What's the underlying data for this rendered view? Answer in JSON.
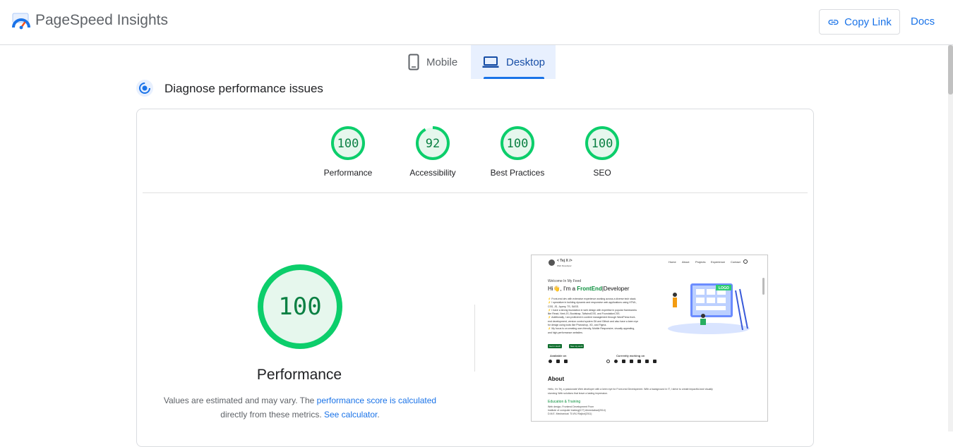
{
  "header": {
    "brand": "PageSpeed Insights",
    "copy_link_label": "Copy Link",
    "docs_label": "Docs"
  },
  "tabs": [
    {
      "label": "Mobile",
      "icon": "phone-icon",
      "selected": false
    },
    {
      "label": "Desktop",
      "icon": "laptop-icon",
      "selected": true
    }
  ],
  "section_title": "Diagnose performance issues",
  "scores": [
    {
      "label": "Performance",
      "value": "100",
      "fraction": 1.0
    },
    {
      "label": "Accessibility",
      "value": "92",
      "fraction": 0.92
    },
    {
      "label": "Best Practices",
      "value": "100",
      "fraction": 1.0
    },
    {
      "label": "SEO",
      "value": "100",
      "fraction": 1.0
    }
  ],
  "main_score": {
    "value": "100",
    "title": "Performance",
    "text1": "Values are estimated and may vary. The ",
    "link1": "performance score is calculated",
    "text2": "directly from these metrics. ",
    "link2": "See calculator",
    "text3": "."
  },
  "preview": {
    "logo_text": "< Tej X />",
    "logo_sub": "Web Developer",
    "nav": [
      "Home",
      "About",
      "Projects",
      "Experience",
      "Contact"
    ],
    "welcome": "Welcome In My Feed",
    "hero_prefix": "Hi👋, I'm a",
    "hero_highlight": "FrontEnd",
    "hero_suffix": "|Developer",
    "bullets": [
      "⚡ Front-end dev with extensive experience working across a diverse tech stack.",
      "⚡ I specialize in building dynamic and responsive web applications using HTML,",
      "CSS, JS, Jquery, TS, SASS.",
      "⚡ I have a strong foundation in web design with expertise in popular frameworks",
      "like React, Next.JS, Bootstrap, TailwindCSS, and FoundationCSS.",
      "⚡ Additionally, I am proficient in content management through WordPress front-",
      "end development, version control system Git and Github and also have a keen eye",
      "for design using tools like Photoshop, XD, and Figma.",
      "⚡ My focus is on creating user-friendly, Mobile Responsive, visually appealing,",
      "and high-performance websites."
    ],
    "btn1": "Get in touch",
    "btn2": "See my work",
    "available_on": "Available on",
    "currently": "Currently working on",
    "about_title": "About",
    "about_text1": "Hello, I'm Tej, a passionate Web developer with a keen eye for Front-end Development. With a background in IT, I strive to create impactful and visually",
    "about_text2": "stunning Web solutions that leave a lasting impression.",
    "edu_title": "Education & Training",
    "edu_lines": [
      "Web design, Frontend Development From",
      "Institute of computer training(ICT) Ahmedabad(2014)",
      "D.M.E. Mechanical: TLVNJ Rajkot(2011)"
    ],
    "illustration_logo": "LOGO"
  },
  "colors": {
    "good": "#0cce6b",
    "good_text": "#0b8043",
    "good_fill": "#e6f7ed",
    "link": "#1a73e8"
  }
}
